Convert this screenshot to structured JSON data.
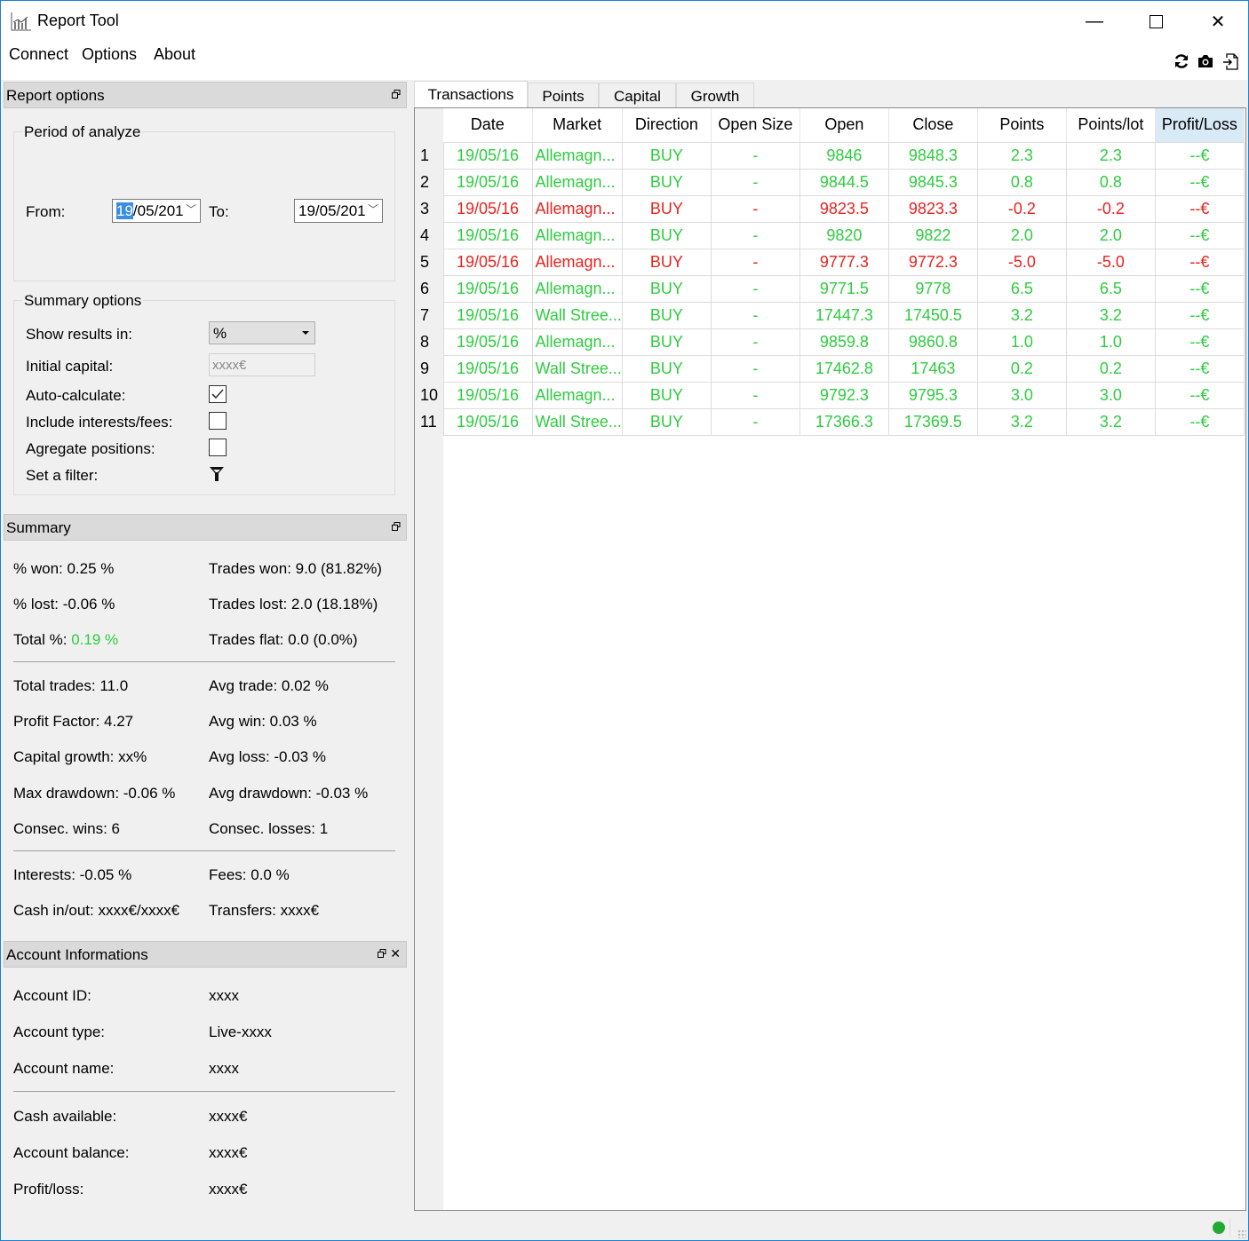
{
  "window": {
    "title": "Report Tool"
  },
  "menu": [
    "Connect",
    "Options",
    "About"
  ],
  "toolbar": {
    "icons": [
      "refresh-icon",
      "camera-icon",
      "export-icon"
    ]
  },
  "report_options": {
    "title": "Report options",
    "period": {
      "label": "Period of analyze",
      "from_label": "From:",
      "from_day": "19",
      "from_rest": "/05/201",
      "to_label": "To:",
      "to_value": "19/05/201"
    },
    "summary_options": {
      "label": "Summary options",
      "show_results_label": "Show results in:",
      "show_results_value": "%",
      "initial_capital_label": "Initial capital:",
      "initial_capital_placeholder": "xxxx€",
      "auto_calc_label": "Auto-calculate:",
      "auto_calc": true,
      "include_fees_label": "Include interests/fees:",
      "include_fees": false,
      "aggregate_label": "Agregate positions:",
      "aggregate": false,
      "filter_label": "Set a filter:"
    }
  },
  "summary": {
    "title": "Summary",
    "won_pct": "% won: 0.25 %",
    "trades_won": "Trades won: 9.0 (81.82%)",
    "lost_pct": "% lost: -0.06 %",
    "trades_lost": "Trades lost: 2.0 (18.18%)",
    "total_label": "Total %: ",
    "total_value": "0.19 %",
    "trades_flat": "Trades flat: 0.0 (0.0%)",
    "total_trades": "Total trades: 11.0",
    "avg_trade": "Avg trade: 0.02 %",
    "profit_factor": "Profit Factor: 4.27",
    "avg_win": "Avg win: 0.03 %",
    "capital_growth": "Capital growth: xx%",
    "avg_loss": "Avg loss: -0.03 %",
    "max_drawdown": "Max drawdown: -0.06 %",
    "avg_drawdown": "Avg drawdown: -0.03 %",
    "consec_wins": "Consec. wins: 6",
    "consec_losses": "Consec. losses: 1",
    "interests": "Interests: -0.05 %",
    "fees": "Fees: 0.0 %",
    "cash_inout": "Cash in/out: xxxx€/xxxx€",
    "transfers": "Transfers: xxxx€"
  },
  "account": {
    "title": "Account Informations",
    "id_label": "Account ID:",
    "id": "xxxx",
    "type_label": "Account type:",
    "type": "Live-xxxx",
    "name_label": "Account name:",
    "name": "xxxx",
    "cash_label": "Cash available:",
    "cash": "xxxx€",
    "balance_label": "Account balance:",
    "balance": "xxxx€",
    "pl_label": "Profit/loss:",
    "pl": "xxxx€"
  },
  "tabs": [
    "Transactions",
    "Points",
    "Capital",
    "Growth"
  ],
  "table": {
    "columns": [
      "Date",
      "Market",
      "Direction",
      "Open Size",
      "Open",
      "Close",
      "Points",
      "Points/lot",
      "Profit/Loss"
    ],
    "rows": [
      {
        "n": "1",
        "status": "win",
        "cells": [
          "19/05/16",
          "Allemagn...",
          "BUY",
          "-",
          "9846",
          "9848.3",
          "2.3",
          "2.3",
          "--€"
        ]
      },
      {
        "n": "2",
        "status": "win",
        "cells": [
          "19/05/16",
          "Allemagn...",
          "BUY",
          "-",
          "9844.5",
          "9845.3",
          "0.8",
          "0.8",
          "--€"
        ]
      },
      {
        "n": "3",
        "status": "loss",
        "cells": [
          "19/05/16",
          "Allemagn...",
          "BUY",
          "-",
          "9823.5",
          "9823.3",
          "-0.2",
          "-0.2",
          "--€"
        ]
      },
      {
        "n": "4",
        "status": "win",
        "cells": [
          "19/05/16",
          "Allemagn...",
          "BUY",
          "-",
          "9820",
          "9822",
          "2.0",
          "2.0",
          "--€"
        ]
      },
      {
        "n": "5",
        "status": "loss",
        "cells": [
          "19/05/16",
          "Allemagn...",
          "BUY",
          "-",
          "9777.3",
          "9772.3",
          "-5.0",
          "-5.0",
          "--€"
        ]
      },
      {
        "n": "6",
        "status": "win",
        "cells": [
          "19/05/16",
          "Allemagn...",
          "BUY",
          "-",
          "9771.5",
          "9778",
          "6.5",
          "6.5",
          "--€"
        ]
      },
      {
        "n": "7",
        "status": "win",
        "cells": [
          "19/05/16",
          "Wall Stree...",
          "BUY",
          "-",
          "17447.3",
          "17450.5",
          "3.2",
          "3.2",
          "--€"
        ]
      },
      {
        "n": "8",
        "status": "win",
        "cells": [
          "19/05/16",
          "Allemagn...",
          "BUY",
          "-",
          "9859.8",
          "9860.8",
          "1.0",
          "1.0",
          "--€"
        ]
      },
      {
        "n": "9",
        "status": "win",
        "cells": [
          "19/05/16",
          "Wall Stree...",
          "BUY",
          "-",
          "17462.8",
          "17463",
          "0.2",
          "0.2",
          "--€"
        ]
      },
      {
        "n": "10",
        "status": "win",
        "cells": [
          "19/05/16",
          "Allemagn...",
          "BUY",
          "-",
          "9792.3",
          "9795.3",
          "3.0",
          "3.0",
          "--€"
        ]
      },
      {
        "n": "11",
        "status": "win",
        "cells": [
          "19/05/16",
          "Wall Stree...",
          "BUY",
          "-",
          "17366.3",
          "17369.5",
          "3.2",
          "3.2",
          "--€"
        ]
      }
    ]
  },
  "colors": {
    "win": "#2ecc40",
    "loss": "#e8231f",
    "status_ok": "#22aa33"
  }
}
